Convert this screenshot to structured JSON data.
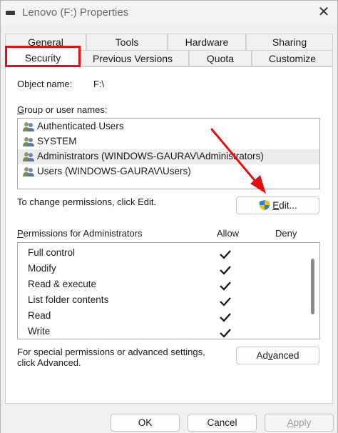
{
  "window": {
    "title": "Lenovo (F:) Properties",
    "close_label": "✕"
  },
  "tabs": {
    "back_row": [
      "General",
      "Tools",
      "Hardware",
      "Sharing"
    ],
    "front_row": [
      "Security",
      "Previous Versions",
      "Quota",
      "Customize"
    ],
    "active": "Security"
  },
  "object": {
    "label": "Object name:",
    "value": "F:\\"
  },
  "groups": {
    "label": "Group or user names:",
    "label_mnemonic": "G",
    "label_rest": "roup or user names:",
    "items": [
      {
        "name": "Authenticated Users",
        "selected": false
      },
      {
        "name": "SYSTEM",
        "selected": false
      },
      {
        "name": "Administrators (WINDOWS-GAURAV\\Administrators)",
        "selected": true
      },
      {
        "name": "Users (WINDOWS-GAURAV\\Users)",
        "selected": false
      }
    ]
  },
  "change": {
    "text": "To change permissions, click Edit.",
    "edit_mnemonic": "E",
    "edit_rest": "dit..."
  },
  "permissions": {
    "label_mnemonic": "P",
    "label_rest": "ermissions for Administrators",
    "allow_label": "Allow",
    "deny_label": "Deny",
    "rows": [
      {
        "name": "Full control",
        "allow": true,
        "deny": false
      },
      {
        "name": "Modify",
        "allow": true,
        "deny": false
      },
      {
        "name": "Read & execute",
        "allow": true,
        "deny": false
      },
      {
        "name": "List folder contents",
        "allow": true,
        "deny": false
      },
      {
        "name": "Read",
        "allow": true,
        "deny": false
      },
      {
        "name": "Write",
        "allow": true,
        "deny": false
      }
    ]
  },
  "special": {
    "line1": "For special permissions or advanced settings,",
    "line2": "click Advanced.",
    "advanced_pre": "Ad",
    "advanced_mnemonic": "v",
    "advanced_post": "anced"
  },
  "footer": {
    "ok_label": "OK",
    "cancel_label": "Cancel",
    "apply_mnemonic": "A",
    "apply_rest": "pply"
  },
  "colors": {
    "highlight_red": "#e01010",
    "arrow_red": "#e01010"
  }
}
